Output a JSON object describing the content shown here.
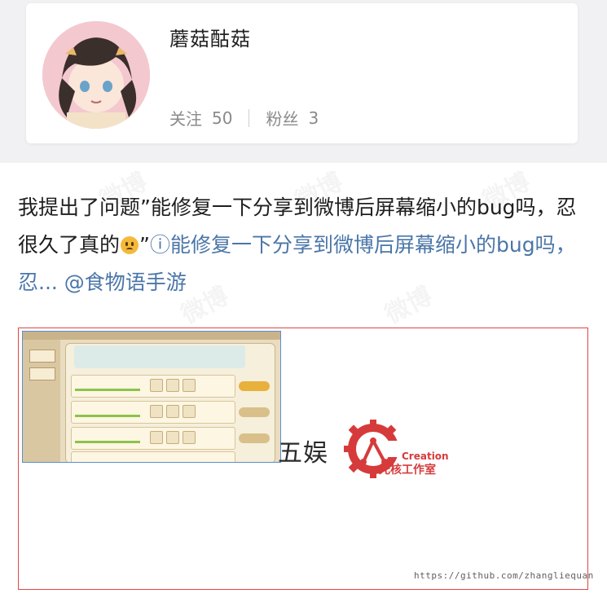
{
  "profile": {
    "username": "蘑菇酤菇",
    "stats": [
      {
        "label": "关注",
        "value": "50"
      },
      {
        "label": "粉丝",
        "value": "3"
      }
    ]
  },
  "post": {
    "text_main": "我提出了问题”能修复一下分享到微博后屏幕缩小的bug吗，忍很久了真的",
    "text_close_quote": "”",
    "link_text": "能修复一下分享到微博后屏幕缩小的bug吗，忍...",
    "mention": "@食物语手游"
  },
  "image": {
    "partial_logo_text": "五娱",
    "studio_en": "Creation",
    "studio_cn": "光核工作室"
  },
  "watermark": {
    "url": "https://github.com/zhangliequan",
    "bg_text": "微博"
  },
  "colors": {
    "link": "#4b76a8",
    "accent_red": "#d63b3b"
  }
}
